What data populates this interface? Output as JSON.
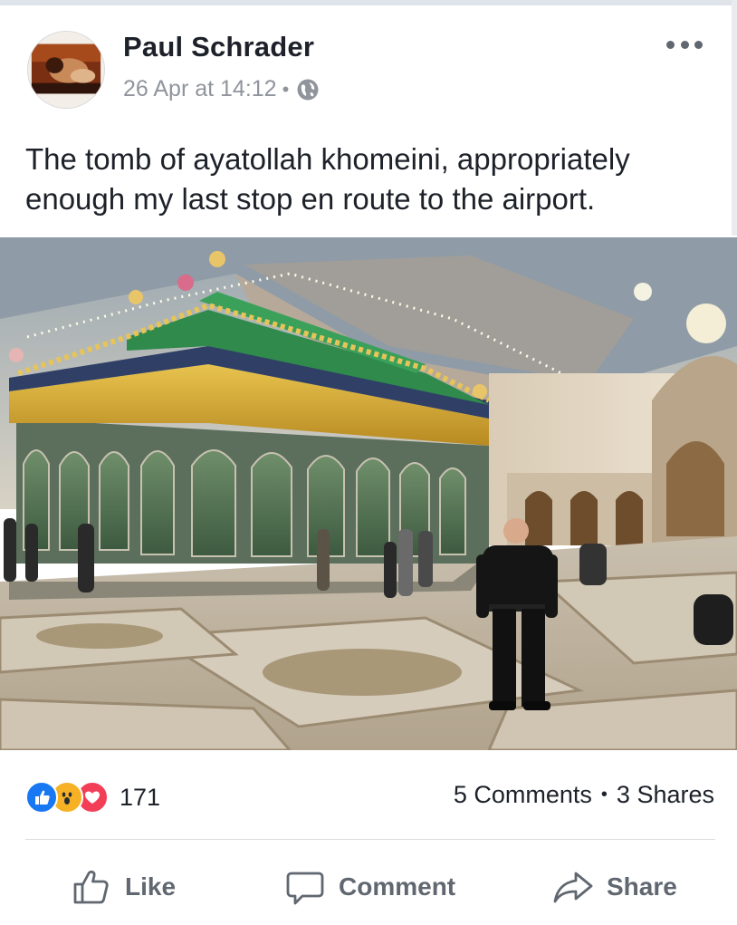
{
  "post": {
    "author": "Paul Schrader",
    "timestamp": "26 Apr at 14:12",
    "meta_separator": "•",
    "privacy_icon": "globe-icon",
    "menu_icon": "more-options-icon",
    "text": "The tomb of ayatollah khomeini, appropriately enough my last stop en route to the airport."
  },
  "reactions": {
    "icons": [
      "like-reaction-icon",
      "wow-reaction-icon",
      "love-reaction-icon"
    ],
    "count": "171"
  },
  "engagement": {
    "comments": "5 Comments",
    "separator": "•",
    "shares": "3 Shares"
  },
  "actions": {
    "like": "Like",
    "comment": "Comment",
    "share": "Share"
  },
  "colors": {
    "like_blue": "#1877f2",
    "wow_yellow": "#f7b125",
    "love_red": "#f33e58",
    "secondary_text": "#90949c",
    "action_gray": "#606770"
  }
}
